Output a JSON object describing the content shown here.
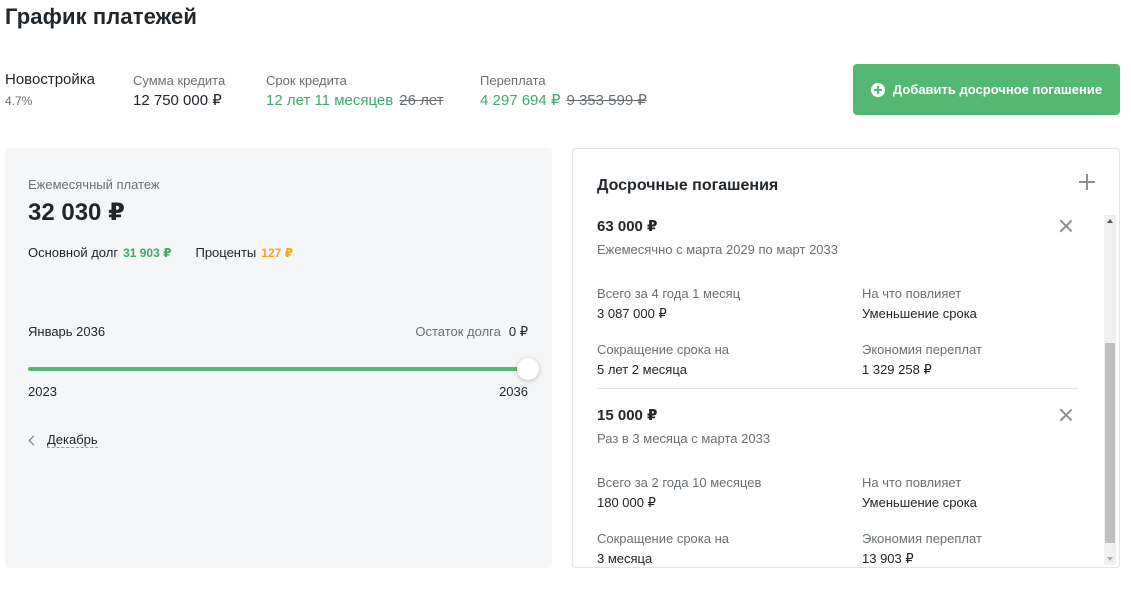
{
  "page": {
    "title": "График платежей"
  },
  "summary": {
    "program_name": "Новостройка",
    "rate": "4.7%",
    "loan_amount_label": "Сумма кредита",
    "loan_amount": "12 750 000 ₽",
    "term_label": "Срок кредита",
    "term_new": "12 лет 11 месяцев",
    "term_old": "26 лет",
    "overpayment_label": "Переплата",
    "overpayment_new": "4 297 694 ₽",
    "overpayment_old": "9 353 599 ₽",
    "add_button_label": "Добавить досрочное погашение"
  },
  "monthly": {
    "label": "Ежемесячный платеж",
    "amount": "32 030 ₽",
    "principal_label": "Основной долг",
    "principal_value": "31 903 ₽",
    "interest_label": "Проценты",
    "interest_value": "127 ₽",
    "selected_month": "Январь 2036",
    "balance_label": "Остаток долга",
    "balance_value": "0 ₽",
    "slider_progress": 1.0,
    "year_start": "2023",
    "year_end": "2036",
    "prev_month_label": "Декабрь"
  },
  "early": {
    "title": "Досрочные погашения",
    "payments": [
      {
        "amount": "63 000 ₽",
        "description": "Ежемесячно с марта 2029 по март 2033",
        "total_label": "Всего за 4 года 1 месяц",
        "total_value": "3 087 000 ₽",
        "effect_label": "На что повлияет",
        "effect_value": "Уменьшение срока",
        "reduction_label": "Сокращение срока на",
        "reduction_value": "5 лет 2 месяца",
        "savings_label": "Экономия переплат",
        "savings_value": "1 329 258 ₽"
      },
      {
        "amount": "15 000 ₽",
        "description": "Раз в 3 месяца с марта 2033",
        "total_label": "Всего за 2 года 10 месяцев",
        "total_value": "180 000 ₽",
        "effect_label": "На что повлияет",
        "effect_value": "Уменьшение срока",
        "reduction_label": "Сокращение срока на",
        "reduction_value": "3 месяца",
        "savings_label": "Экономия переплат",
        "savings_value": "13 903 ₽"
      }
    ]
  },
  "colors": {
    "accent": "#54b872",
    "positive_text": "#3fa968",
    "interest": "#f5a623"
  }
}
